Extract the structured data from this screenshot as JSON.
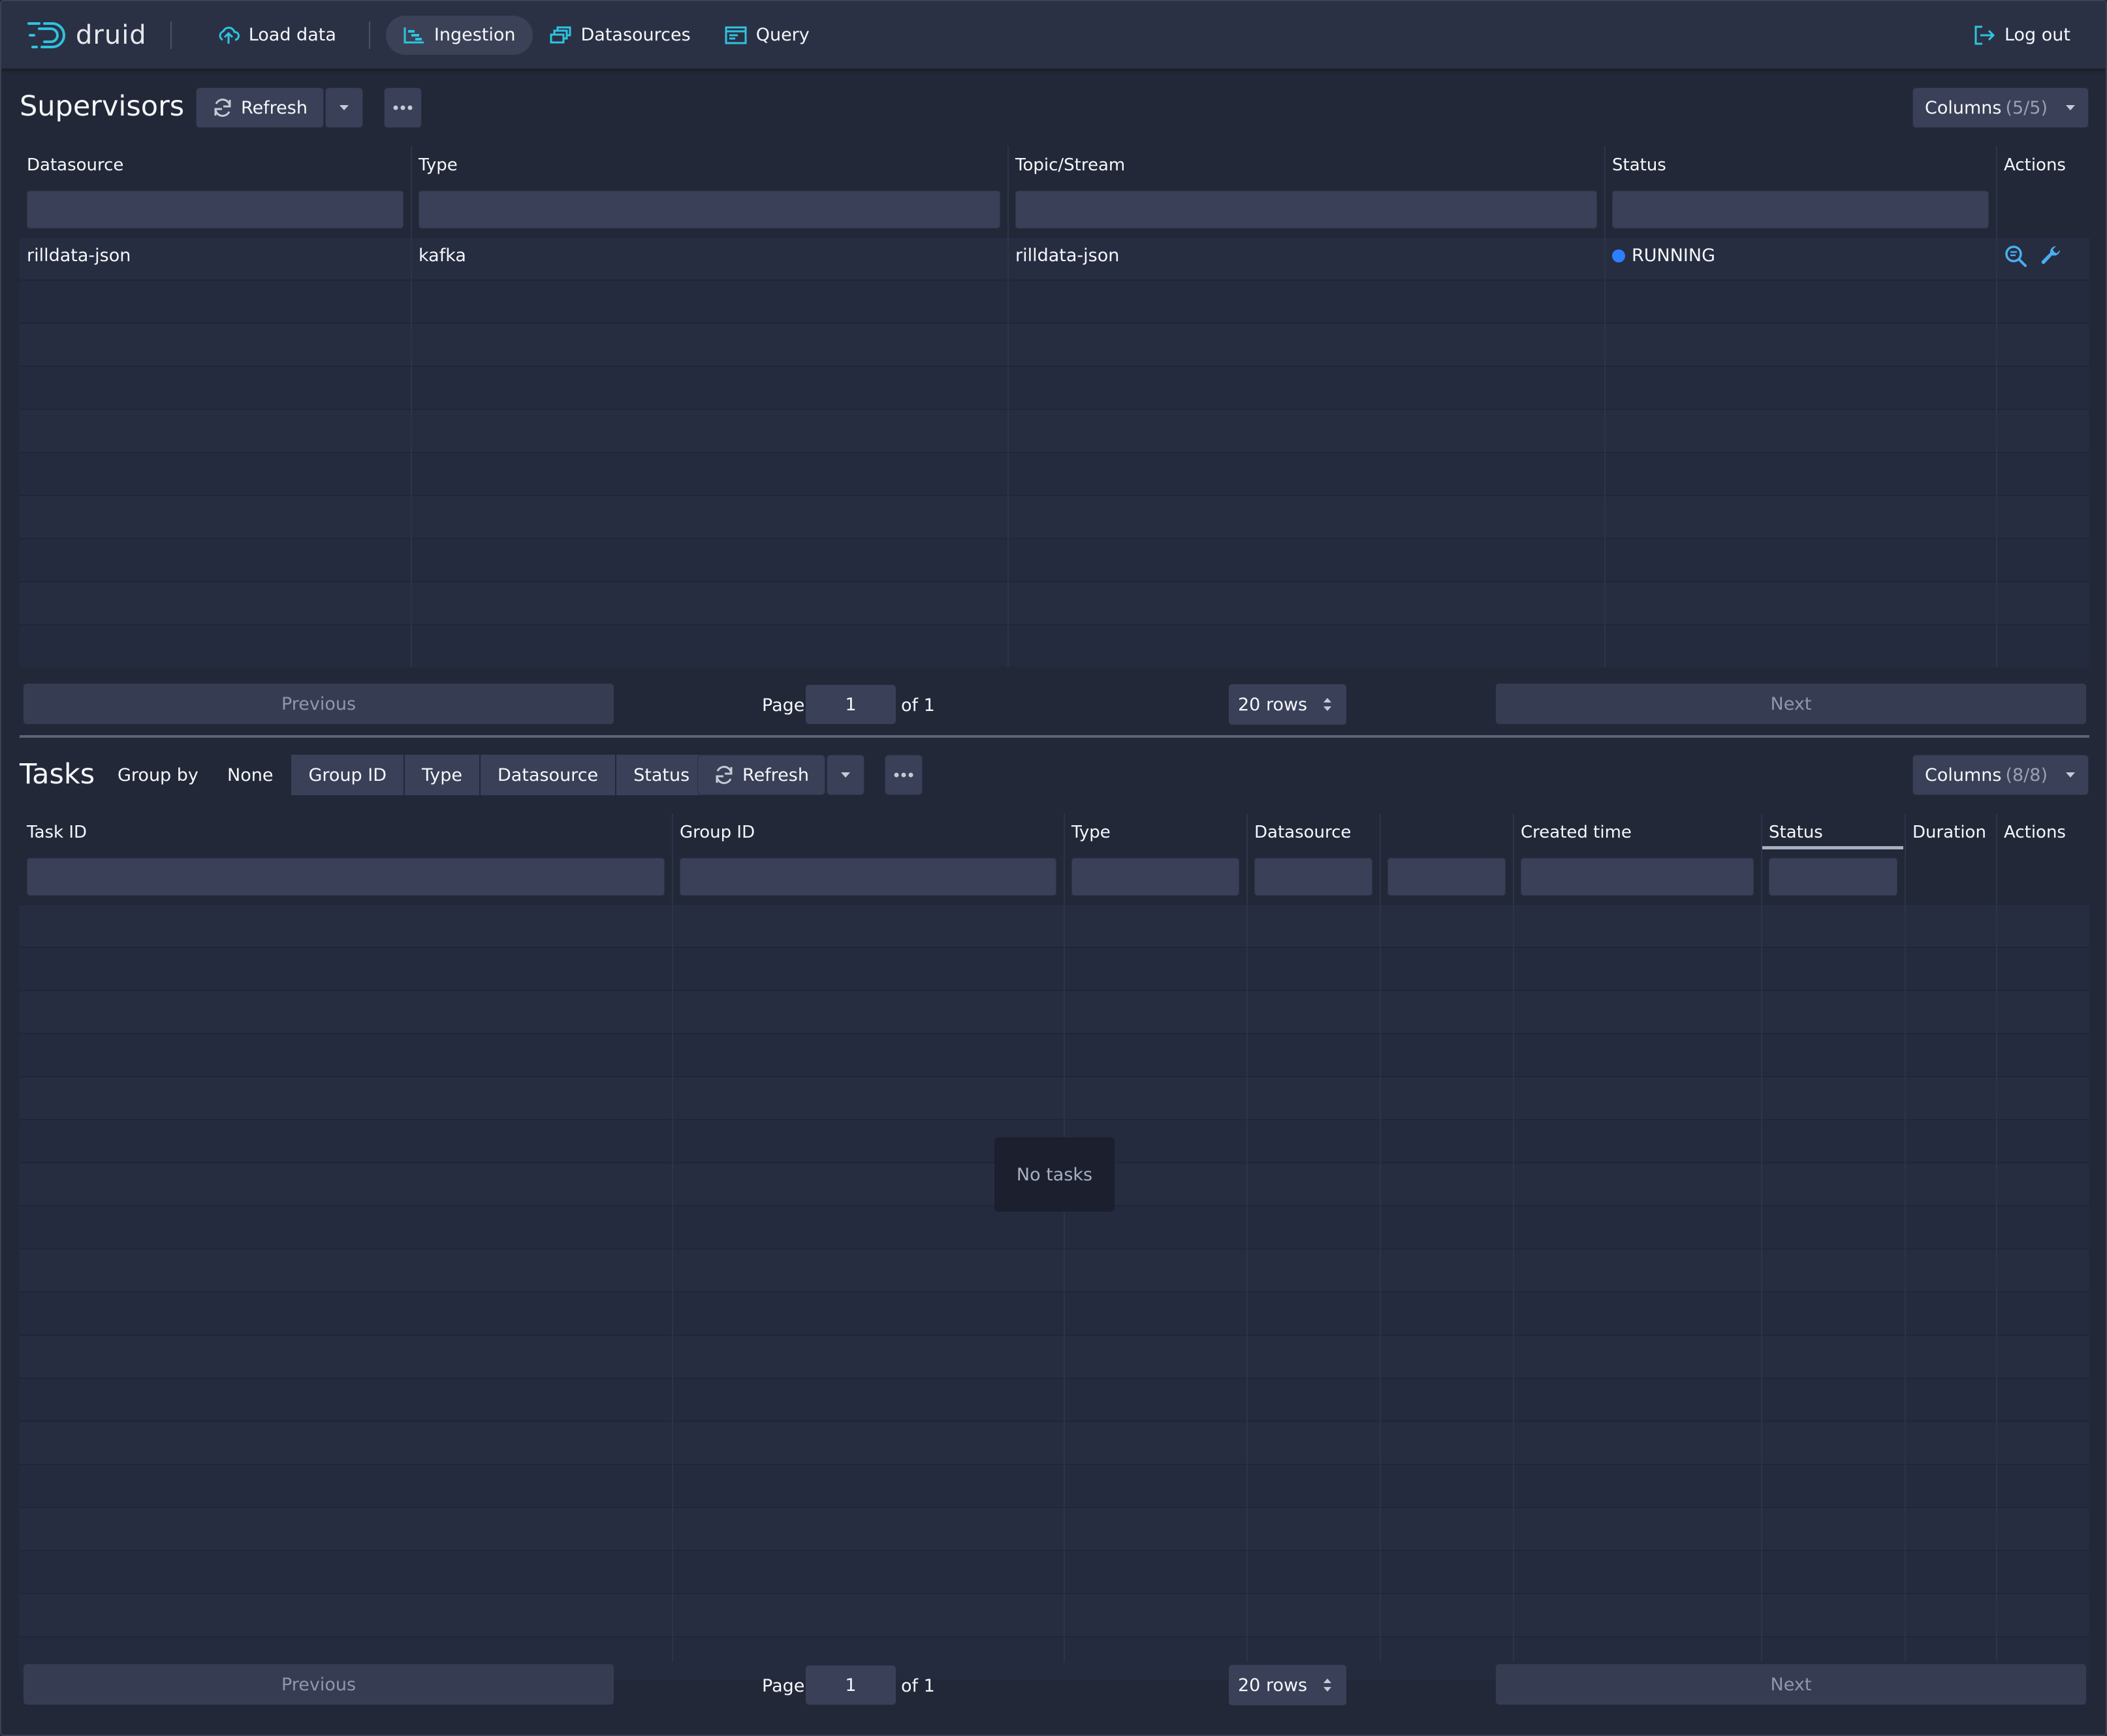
{
  "nav": {
    "brand": "druid",
    "items": [
      {
        "label": "Load data",
        "icon": "cloud-upload-icon"
      },
      {
        "label": "Ingestion",
        "icon": "gantt-chart-icon",
        "active": true
      },
      {
        "label": "Datasources",
        "icon": "multi-select-icon"
      },
      {
        "label": "Query",
        "icon": "application-icon"
      }
    ],
    "logout": "Log out"
  },
  "supervisors": {
    "title": "Supervisors",
    "refresh": "Refresh",
    "columns_label": "Columns",
    "columns_count": "(5/5)",
    "headers": [
      "Datasource",
      "Type",
      "Topic/Stream",
      "Status",
      "Actions"
    ],
    "rows": [
      {
        "datasource": "rilldata-json",
        "type": "kafka",
        "topic": "rilldata-json",
        "status": "RUNNING"
      }
    ],
    "status_color": "#2d7fff",
    "pagination": {
      "previous": "Previous",
      "page_label": "Page",
      "page": "1",
      "of": "of 1",
      "rows": "20 rows",
      "next": "Next"
    }
  },
  "tasks": {
    "title": "Tasks",
    "group_by_label": "Group by",
    "group_by_options": [
      "None",
      "Group ID",
      "Type",
      "Datasource",
      "Status"
    ],
    "group_by_selected": "None",
    "refresh": "Refresh",
    "columns_label": "Columns",
    "columns_count": "(8/8)",
    "headers": [
      "Task ID",
      "Group ID",
      "Type",
      "Datasource",
      "",
      "Created time",
      "Status",
      "Duration",
      "Actions"
    ],
    "empty_message": "No tasks",
    "pagination": {
      "previous": "Previous",
      "page_label": "Page",
      "page": "1",
      "of": "of 1",
      "rows": "20 rows",
      "next": "Next"
    }
  },
  "colors": {
    "background": "#232839",
    "navbar": "#2b3145",
    "accent": "#2ec4e0",
    "icon_blue": "#48aff0"
  }
}
